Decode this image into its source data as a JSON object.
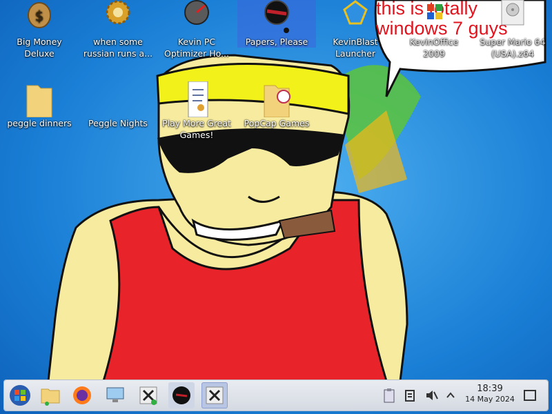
{
  "desktop": {
    "icons_row1": [
      {
        "label": "Big Money\nDeluxe",
        "icon": "money-bag-icon"
      },
      {
        "label": "when some\nrussian runs a...",
        "icon": "gear-icon"
      },
      {
        "label": "Kevin PC\nOptimizer Ho...",
        "icon": "speedometer-icon"
      },
      {
        "label": "Papers, Please",
        "icon": "papers-please-icon",
        "selected": true
      },
      {
        "label": "KevinBlast\nLauncher",
        "icon": "bejeweled-icon"
      },
      {
        "label": "KevinOffice\n2009",
        "icon": "office-icon"
      },
      {
        "label": "Super Mario 64\n(USA).z64",
        "icon": "disc-icon"
      }
    ],
    "icons_row2": [
      {
        "label": "peggle dinners",
        "icon": "folder-icon"
      },
      {
        "label": "Peggle Nights",
        "icon": "peggle-icon"
      },
      {
        "label": "Play More Great\nGames!",
        "icon": "document-icon"
      },
      {
        "label": "PopCap Games",
        "icon": "popcap-folder-icon"
      }
    ],
    "speech_bubble": "this is totally\nwindows 7 guys"
  },
  "taskbar": {
    "buttons": [
      {
        "name": "start-button",
        "icon": "start-orb-icon"
      },
      {
        "name": "file-manager-button",
        "icon": "folder-icon"
      },
      {
        "name": "firefox-button",
        "icon": "firefox-icon"
      },
      {
        "name": "control-panel-button",
        "icon": "computer-icon"
      },
      {
        "name": "wine-app-button",
        "icon": "x-app-icon"
      },
      {
        "name": "papers-please-task",
        "icon": "papers-please-icon"
      },
      {
        "name": "x-app-task",
        "icon": "x-app-icon"
      }
    ],
    "clock": {
      "time": "18:39",
      "date": "14 May 2024"
    }
  },
  "colors": {
    "desktop_blue": "#1a7fd6",
    "speech_red": "#e0141e",
    "tank_top_red": "#e8242a",
    "skin": "#f7eba0",
    "headband_yellow": "#f2f21a"
  }
}
